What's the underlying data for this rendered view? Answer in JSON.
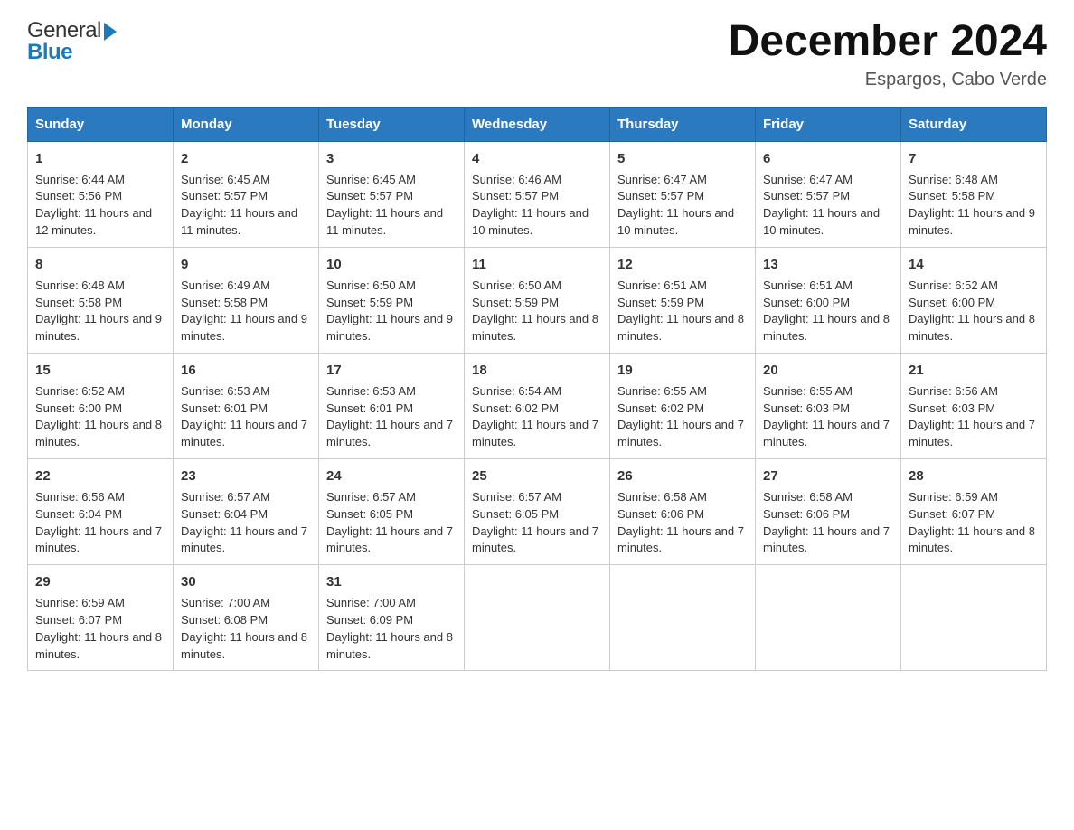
{
  "header": {
    "month_title": "December 2024",
    "location": "Espargos, Cabo Verde",
    "logo_general": "General",
    "logo_blue": "Blue"
  },
  "days_of_week": [
    "Sunday",
    "Monday",
    "Tuesday",
    "Wednesday",
    "Thursday",
    "Friday",
    "Saturday"
  ],
  "weeks": [
    [
      {
        "day": "1",
        "sunrise": "6:44 AM",
        "sunset": "5:56 PM",
        "daylight": "11 hours and 12 minutes."
      },
      {
        "day": "2",
        "sunrise": "6:45 AM",
        "sunset": "5:57 PM",
        "daylight": "11 hours and 11 minutes."
      },
      {
        "day": "3",
        "sunrise": "6:45 AM",
        "sunset": "5:57 PM",
        "daylight": "11 hours and 11 minutes."
      },
      {
        "day": "4",
        "sunrise": "6:46 AM",
        "sunset": "5:57 PM",
        "daylight": "11 hours and 10 minutes."
      },
      {
        "day": "5",
        "sunrise": "6:47 AM",
        "sunset": "5:57 PM",
        "daylight": "11 hours and 10 minutes."
      },
      {
        "day": "6",
        "sunrise": "6:47 AM",
        "sunset": "5:57 PM",
        "daylight": "11 hours and 10 minutes."
      },
      {
        "day": "7",
        "sunrise": "6:48 AM",
        "sunset": "5:58 PM",
        "daylight": "11 hours and 9 minutes."
      }
    ],
    [
      {
        "day": "8",
        "sunrise": "6:48 AM",
        "sunset": "5:58 PM",
        "daylight": "11 hours and 9 minutes."
      },
      {
        "day": "9",
        "sunrise": "6:49 AM",
        "sunset": "5:58 PM",
        "daylight": "11 hours and 9 minutes."
      },
      {
        "day": "10",
        "sunrise": "6:50 AM",
        "sunset": "5:59 PM",
        "daylight": "11 hours and 9 minutes."
      },
      {
        "day": "11",
        "sunrise": "6:50 AM",
        "sunset": "5:59 PM",
        "daylight": "11 hours and 8 minutes."
      },
      {
        "day": "12",
        "sunrise": "6:51 AM",
        "sunset": "5:59 PM",
        "daylight": "11 hours and 8 minutes."
      },
      {
        "day": "13",
        "sunrise": "6:51 AM",
        "sunset": "6:00 PM",
        "daylight": "11 hours and 8 minutes."
      },
      {
        "day": "14",
        "sunrise": "6:52 AM",
        "sunset": "6:00 PM",
        "daylight": "11 hours and 8 minutes."
      }
    ],
    [
      {
        "day": "15",
        "sunrise": "6:52 AM",
        "sunset": "6:00 PM",
        "daylight": "11 hours and 8 minutes."
      },
      {
        "day": "16",
        "sunrise": "6:53 AM",
        "sunset": "6:01 PM",
        "daylight": "11 hours and 7 minutes."
      },
      {
        "day": "17",
        "sunrise": "6:53 AM",
        "sunset": "6:01 PM",
        "daylight": "11 hours and 7 minutes."
      },
      {
        "day": "18",
        "sunrise": "6:54 AM",
        "sunset": "6:02 PM",
        "daylight": "11 hours and 7 minutes."
      },
      {
        "day": "19",
        "sunrise": "6:55 AM",
        "sunset": "6:02 PM",
        "daylight": "11 hours and 7 minutes."
      },
      {
        "day": "20",
        "sunrise": "6:55 AM",
        "sunset": "6:03 PM",
        "daylight": "11 hours and 7 minutes."
      },
      {
        "day": "21",
        "sunrise": "6:56 AM",
        "sunset": "6:03 PM",
        "daylight": "11 hours and 7 minutes."
      }
    ],
    [
      {
        "day": "22",
        "sunrise": "6:56 AM",
        "sunset": "6:04 PM",
        "daylight": "11 hours and 7 minutes."
      },
      {
        "day": "23",
        "sunrise": "6:57 AM",
        "sunset": "6:04 PM",
        "daylight": "11 hours and 7 minutes."
      },
      {
        "day": "24",
        "sunrise": "6:57 AM",
        "sunset": "6:05 PM",
        "daylight": "11 hours and 7 minutes."
      },
      {
        "day": "25",
        "sunrise": "6:57 AM",
        "sunset": "6:05 PM",
        "daylight": "11 hours and 7 minutes."
      },
      {
        "day": "26",
        "sunrise": "6:58 AM",
        "sunset": "6:06 PM",
        "daylight": "11 hours and 7 minutes."
      },
      {
        "day": "27",
        "sunrise": "6:58 AM",
        "sunset": "6:06 PM",
        "daylight": "11 hours and 7 minutes."
      },
      {
        "day": "28",
        "sunrise": "6:59 AM",
        "sunset": "6:07 PM",
        "daylight": "11 hours and 8 minutes."
      }
    ],
    [
      {
        "day": "29",
        "sunrise": "6:59 AM",
        "sunset": "6:07 PM",
        "daylight": "11 hours and 8 minutes."
      },
      {
        "day": "30",
        "sunrise": "7:00 AM",
        "sunset": "6:08 PM",
        "daylight": "11 hours and 8 minutes."
      },
      {
        "day": "31",
        "sunrise": "7:00 AM",
        "sunset": "6:09 PM",
        "daylight": "11 hours and 8 minutes."
      },
      null,
      null,
      null,
      null
    ]
  ],
  "labels": {
    "sunrise": "Sunrise:",
    "sunset": "Sunset:",
    "daylight": "Daylight:"
  }
}
